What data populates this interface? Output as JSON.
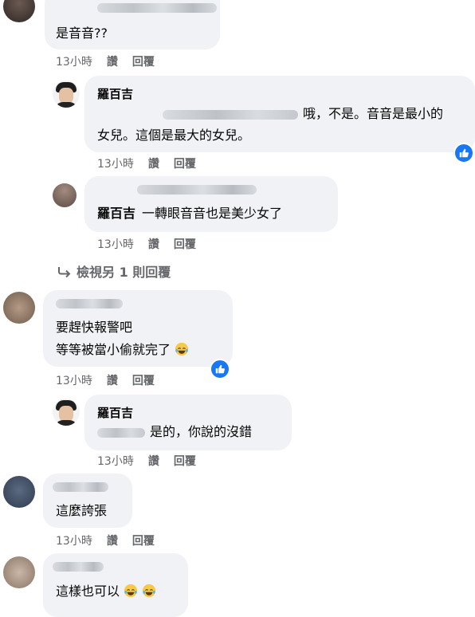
{
  "comments": [
    {
      "text_lines": [
        "是音音??"
      ],
      "time": "13小時",
      "like": "讚",
      "reply": "回覆"
    },
    {
      "author": "羅百吉",
      "text_lines": [
        "哦，不是。音音是最小的",
        "女兒。這個是最大的女兒。"
      ],
      "time": "13小時",
      "like": "讚",
      "reply": "回覆"
    },
    {
      "author": "羅百吉",
      "text": "一轉眼音音也是美少女了",
      "time": "13小時",
      "like": "讚",
      "reply": "回覆"
    },
    {
      "text_lines": [
        "要趕快報警吧",
        "等等被當小偷就完了"
      ],
      "time": "13小時",
      "like": "讚",
      "reply": "回覆"
    },
    {
      "author": "羅百吉",
      "text": "是的，你說的沒錯",
      "time": "13小時",
      "like": "讚",
      "reply": "回覆"
    },
    {
      "text": "這麼誇張",
      "time": "13小時",
      "like": "讚",
      "reply": "回覆"
    },
    {
      "text": "這樣也可以"
    }
  ],
  "more_replies": "檢視另 1 則回覆",
  "icons": {
    "like_badge": "thumbs-up-icon",
    "emoji": "laughing-tears-emoji",
    "reply_arrow": "reply-arrow-icon"
  },
  "colors": {
    "bubble": "#f0f2f5",
    "meta": "#65676b",
    "like_blue": "#1877f2"
  }
}
